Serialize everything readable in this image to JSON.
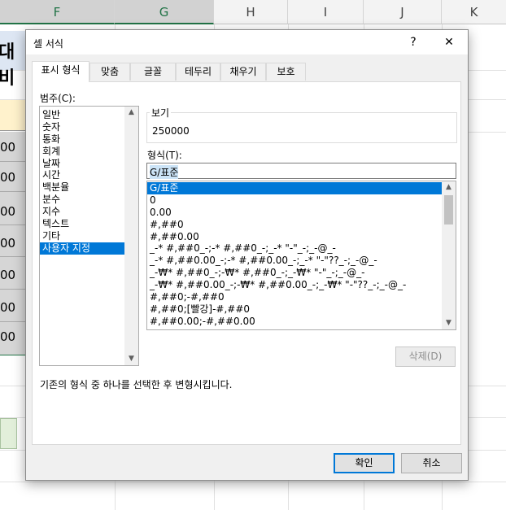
{
  "sheet": {
    "columns": [
      "F",
      "G",
      "H",
      "I",
      "J",
      "K"
    ],
    "partial_cell_text": "대비",
    "row_fragments": [
      "00",
      "00",
      "00",
      "00",
      "00",
      "00",
      "00"
    ]
  },
  "dialog": {
    "title": "셀 서식",
    "help_label": "?",
    "close_label": "✕",
    "tabs": [
      "표시 형식",
      "맞춤",
      "글꼴",
      "테두리",
      "채우기",
      "보호"
    ],
    "category_label": "범주(C):",
    "categories": [
      "일반",
      "숫자",
      "통화",
      "회계",
      "날짜",
      "시간",
      "백분율",
      "분수",
      "지수",
      "텍스트",
      "기타",
      "사용자 지정"
    ],
    "selected_category": "사용자 지정",
    "sample_label": "보기",
    "sample_value": "250000",
    "type_label": "형식(T):",
    "type_value": "G/표준",
    "formats": [
      "G/표준",
      "0",
      "0.00",
      "#,##0",
      "#,##0.00",
      "_-* #,##0_-;-* #,##0_-;_-* \"-\"_-;_-@_-",
      "_-* #,##0.00_-;-* #,##0.00_-;_-* \"-\"??_-;_-@_-",
      "_-₩* #,##0_-;-₩* #,##0_-;_-₩* \"-\"_-;_-@_-",
      "_-₩* #,##0.00_-;-₩* #,##0.00_-;_-₩* \"-\"??_-;_-@_-",
      "#,##0;-#,##0",
      "#,##0;[빨강]-#,##0",
      "#,##0.00;-#,##0.00"
    ],
    "selected_format": "G/표준",
    "delete_label": "삭제(D)",
    "description": "기존의 형식 중 하나를 선택한 후 변형시킵니다.",
    "ok_label": "확인",
    "cancel_label": "취소"
  },
  "colors": {
    "selection": "#0078d7",
    "sheet_selected_header": "#217346",
    "cell_fill_yellow": "#fff2cc",
    "cell_fill_green": "#e2efda"
  }
}
